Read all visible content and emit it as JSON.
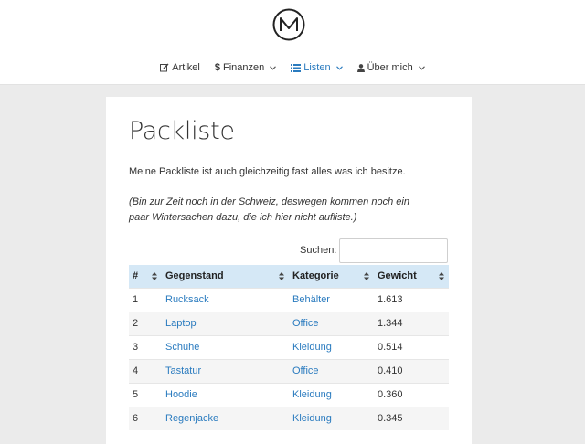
{
  "nav": {
    "items": [
      {
        "label": "Artikel",
        "icon": "edit-icon",
        "has_dropdown": false,
        "active": false
      },
      {
        "label": "Finanzen",
        "icon": "dollar-icon",
        "has_dropdown": true,
        "active": false
      },
      {
        "label": "Listen",
        "icon": "list-icon",
        "has_dropdown": true,
        "active": true
      },
      {
        "label": "Über mich",
        "icon": "user-icon",
        "has_dropdown": true,
        "active": false
      }
    ]
  },
  "page": {
    "title": "Packliste",
    "intro": "Meine Packliste ist auch gleichzeitig fast alles was ich besitze.",
    "note": "(Bin zur Zeit noch in der Schweiz, deswegen kommen noch ein paar Wintersachen dazu, die ich hier nicht aufliste.)"
  },
  "search": {
    "label": "Suchen:",
    "value": ""
  },
  "table": {
    "headers": [
      "#",
      "Gegenstand",
      "Kategorie",
      "Gewicht"
    ],
    "rows": [
      {
        "num": "1",
        "item": "Rucksack",
        "category": "Behälter",
        "weight": "1.613"
      },
      {
        "num": "2",
        "item": "Laptop",
        "category": "Office",
        "weight": "1.344"
      },
      {
        "num": "3",
        "item": "Schuhe",
        "category": "Kleidung",
        "weight": "0.514"
      },
      {
        "num": "4",
        "item": "Tastatur",
        "category": "Office",
        "weight": "0.410"
      },
      {
        "num": "5",
        "item": "Hoodie",
        "category": "Kleidung",
        "weight": "0.360"
      },
      {
        "num": "6",
        "item": "Regenjacke",
        "category": "Kleidung",
        "weight": "0.345"
      }
    ]
  },
  "colors": {
    "accent": "#2a7bbf",
    "header_bg": "#d5e8f6",
    "page_bg": "#ebebeb"
  }
}
